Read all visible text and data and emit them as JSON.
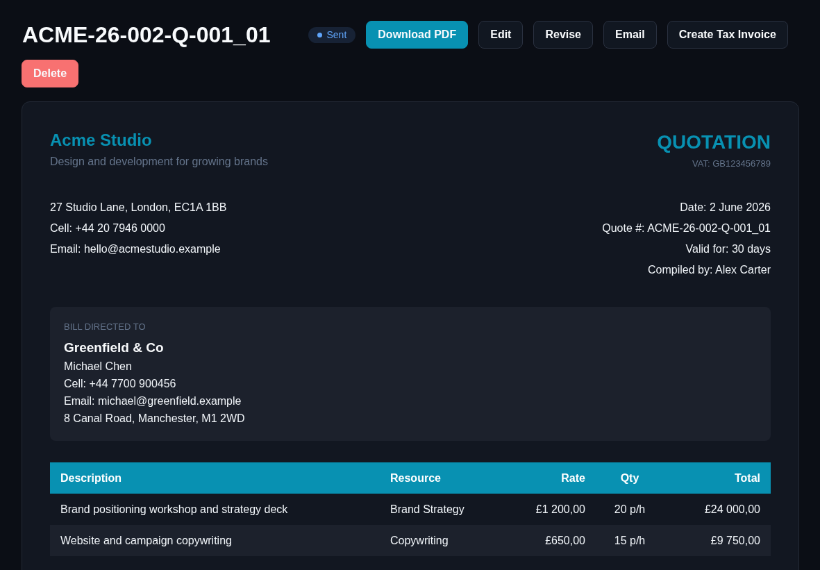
{
  "header": {
    "title": "ACME-26-002-Q-001_01",
    "status": {
      "label": "Sent"
    },
    "buttons": [
      {
        "label": "Download PDF",
        "kind": "primary"
      },
      {
        "label": "Edit",
        "kind": "secondary"
      },
      {
        "label": "Revise",
        "kind": "secondary"
      },
      {
        "label": "Email",
        "kind": "secondary"
      },
      {
        "label": "Create Tax Invoice",
        "kind": "secondary"
      },
      {
        "label": "Delete",
        "kind": "danger"
      }
    ]
  },
  "document": {
    "company": {
      "name": "Acme Studio",
      "tagline": "Design and development for growing brands",
      "contact_lines": [
        "27 Studio Lane, London, EC1A 1BB",
        "Cell: +44 20 7946 0000",
        "Email: hello@acmestudio.example"
      ]
    },
    "doc_type": "QUOTATION",
    "vat": "VAT: GB123456789",
    "details": [
      "Date: 2 June 2026",
      "Quote #: ACME-26-002-Q-001_01",
      "Valid for: 30 days",
      "Compiled by: Alex Carter"
    ],
    "bill_to": {
      "heading": "BILL DIRECTED TO",
      "name": "Greenfield & Co",
      "lines": [
        "Michael Chen",
        "Cell: +44 7700 900456",
        "Email: michael@greenfield.example",
        "8 Canal Road, Manchester, M1 2WD"
      ]
    },
    "table": {
      "columns": [
        "Description",
        "Resource",
        "Rate",
        "Qty",
        "Total"
      ],
      "rows": [
        [
          "Brand positioning workshop and strategy deck",
          "Brand Strategy",
          "£1 200,00",
          "20 p/h",
          "£24 000,00"
        ],
        [
          "Website and campaign copywriting",
          "Copywriting",
          "£650,00",
          "15 p/h",
          "£9 750,00"
        ]
      ]
    }
  }
}
